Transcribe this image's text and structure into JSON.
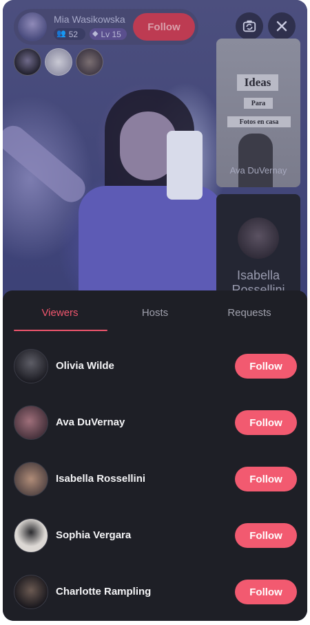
{
  "host": {
    "name": "Mia Wasikowska",
    "viewer_count": "52",
    "level": "Lv 15",
    "follow_label": "Follow"
  },
  "icons": {
    "viewers": "people-icon",
    "level": "diamond-icon",
    "flip_camera": "flip-camera-icon",
    "close": "close-icon"
  },
  "co_hosts": [
    {
      "name": "Ava DuVernay",
      "overlay_title": "Ideas",
      "overlay_sub1": "Para",
      "overlay_sub2": "Fotos en casa"
    },
    {
      "name": "Isabella Rossellini"
    }
  ],
  "sheet": {
    "tabs": [
      {
        "label": "Viewers",
        "active": true
      },
      {
        "label": "Hosts",
        "active": false
      },
      {
        "label": "Requests",
        "active": false
      }
    ],
    "viewers": [
      {
        "name": "Olivia Wilde",
        "follow_label": "Follow"
      },
      {
        "name": "Ava DuVernay",
        "follow_label": "Follow"
      },
      {
        "name": "Isabella Rossellini",
        "follow_label": "Follow"
      },
      {
        "name": "Sophia Vergara",
        "follow_label": "Follow"
      },
      {
        "name": "Charlotte Rampling",
        "follow_label": "Follow"
      }
    ]
  },
  "colors": {
    "accent": "#f25a70",
    "sheet_background": "#1e1f26"
  }
}
